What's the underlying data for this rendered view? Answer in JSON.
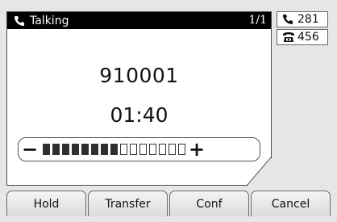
{
  "call": {
    "status": "Talking",
    "call_count": "1/1",
    "number": "910001",
    "duration": "01:40"
  },
  "volume": {
    "minus_label": "−",
    "plus_label": "+",
    "level": 8,
    "max": 15
  },
  "line_keys": [
    {
      "label": "281",
      "icon": "phone-handset-icon"
    },
    {
      "label": "456",
      "icon": "desk-phone-icon"
    }
  ],
  "softkeys": [
    "Hold",
    "Transfer",
    "Conf",
    "Cancel"
  ],
  "colors": {
    "title_bar": "#000000",
    "segment_on": "#2e2e2e",
    "background": "#e6e6e6"
  }
}
